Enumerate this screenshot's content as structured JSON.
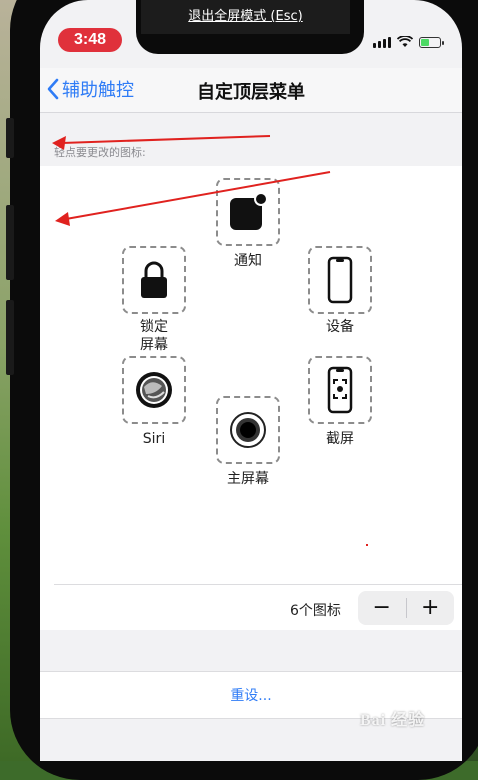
{
  "overlay": {
    "exit_fullscreen": "退出全屏模式 (Esc)"
  },
  "status_bar": {
    "time": "3:48",
    "time_pill_color": "#e0313b",
    "icons": [
      "cellular-signal-icon",
      "wifi-icon",
      "battery-charging-icon"
    ]
  },
  "nav": {
    "back_label": "辅助触控",
    "title": "自定顶层菜单",
    "accent": "#2f7cf6"
  },
  "section_header": "轻点要更改的图标:",
  "icons": {
    "notification": "通知",
    "lock_screen": "锁定屏幕",
    "device": "设备",
    "siri": "Siri",
    "screenshot": "截屏",
    "home": "主屏幕"
  },
  "footer": {
    "icon_count": "6个图标",
    "minus": "−",
    "plus": "+"
  },
  "reset_label": "重设...",
  "watermark": "Bai 经验",
  "annotation_color": "#e0221f"
}
